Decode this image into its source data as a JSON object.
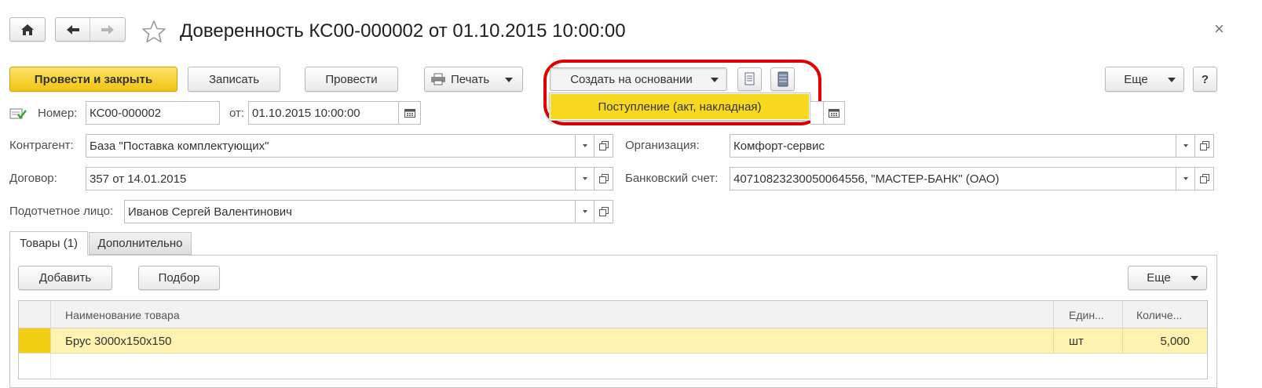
{
  "window": {
    "title": "Доверенность КС00-000002 от 01.10.2015 10:00:00",
    "close_glyph": "×"
  },
  "toolbar": {
    "post_close": "Провести и закрыть",
    "save": "Записать",
    "post": "Провести",
    "print": "Печать",
    "create_based": "Создать на основании",
    "more": "Еще",
    "help": "?",
    "accent": "#f2c511",
    "highlight_color": "#e00000"
  },
  "create_based_menu": {
    "items": [
      "Поступление (акт, накладная)"
    ]
  },
  "header": {
    "number_label": "Номер:",
    "number_value": "КС00-000002",
    "date_label": "от:",
    "date_value": "01.10.2015 10:00:00"
  },
  "form": {
    "counterparty_label": "Контрагент:",
    "counterparty_value": "База \"Поставка комплектующих\"",
    "organization_label": "Организация:",
    "organization_value": "Комфорт-сервис",
    "contract_label": "Договор:",
    "contract_value": "357 от 14.01.2015",
    "bank_account_label": "Банковский счет:",
    "bank_account_value": "40710823230050064556, \"МАСТЕР-БАНК\" (ОАО)",
    "accountable_label": "Подотчетное лицо:",
    "accountable_value": "Иванов Сергей Валентинович"
  },
  "tabs": [
    {
      "label": "Товары (1)",
      "active": true
    },
    {
      "label": "Дополнительно",
      "active": false
    }
  ],
  "goods": {
    "add": "Добавить",
    "select": "Подбор",
    "more": "Еще",
    "columns": [
      "Наименование товара",
      "Един...",
      "Количе..."
    ],
    "rows": [
      {
        "name": "Брус 3000х150х150",
        "unit": "шт",
        "qty": "5,000"
      }
    ],
    "row_highlight": "#fdf2b0"
  }
}
